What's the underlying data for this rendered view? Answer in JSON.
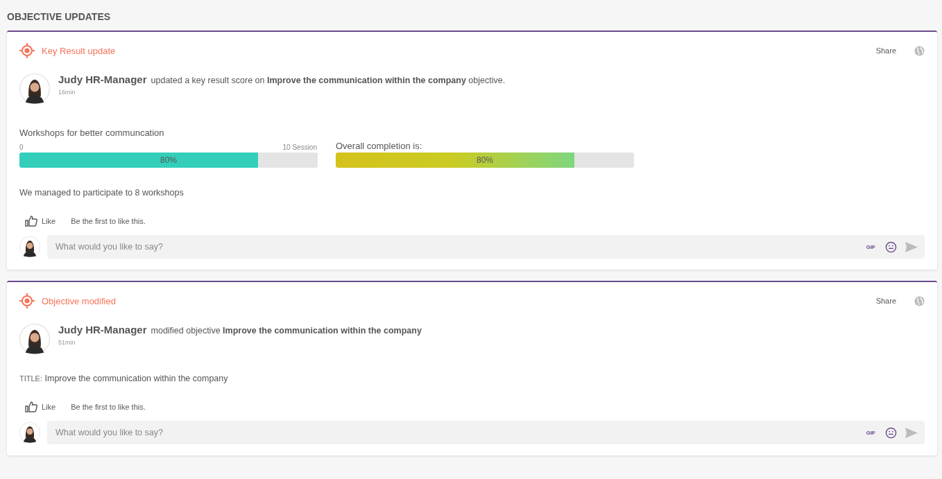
{
  "section_title": "OBJECTIVE UPDATES",
  "updates": [
    {
      "kind": "key_result",
      "type_label": "Key Result update",
      "share": "Share",
      "author": "Judy HR-Manager",
      "action": "updated a key result score on **Improve the communication within the company** objective.",
      "time": "16min",
      "key_result": {
        "name": "Workshops for better communcation",
        "min": "0",
        "max": "10 Session",
        "level": 0.8,
        "reading": "80%"
      },
      "overall": {
        "label": "Overall completion is:",
        "level": 0.8,
        "reading": "80%"
      },
      "comment": "We managed to participate to 8 workshops",
      "like": "Like",
      "likes_text": "Be the first to like this.",
      "reply": {
        "placeholder": "What would you like to say?",
        "gif": "GIF"
      }
    },
    {
      "kind": "objective",
      "type_label": "Objective modified",
      "share": "Share",
      "author": "Judy HR-Manager",
      "action": "modified objective **Improve the communication within the company**",
      "time": "51min",
      "field_label": "TITLE:",
      "field_value": "Improve the communication within the company",
      "like": "Like",
      "likes_text": "Be the first to like this.",
      "reply": {
        "placeholder": "What would you like to say?",
        "gif": "GIF"
      }
    }
  ]
}
